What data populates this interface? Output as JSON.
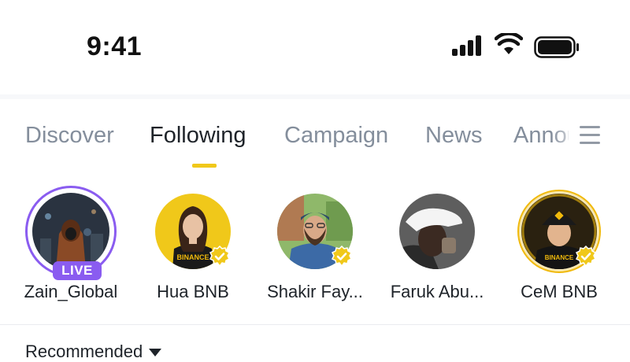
{
  "status_bar": {
    "time": "9:41",
    "icons": [
      "cellular-signal-icon",
      "wifi-icon",
      "battery-icon"
    ]
  },
  "tabs": [
    {
      "label": "Discover",
      "active": false
    },
    {
      "label": "Following",
      "active": true
    },
    {
      "label": "Campaign",
      "active": false
    },
    {
      "label": "News",
      "active": false
    },
    {
      "label": "Announcements",
      "active": false
    }
  ],
  "menu_icon": "hamburger-menu-icon",
  "colors": {
    "accent": "#F0C81A",
    "live": "#8A5CF0",
    "inactive_text": "#848E9C",
    "active_text": "#1E2329"
  },
  "creators": [
    {
      "name": "Zain_Global",
      "badge": "LIVE",
      "verified": false
    },
    {
      "name": "Hua BNB",
      "verified": true
    },
    {
      "name": "Shakir Fay...",
      "verified": true
    },
    {
      "name": "Faruk Abu...",
      "verified": false
    },
    {
      "name": "CeM BNB",
      "verified": true
    }
  ],
  "feed_filter": {
    "label": "Recommended"
  }
}
